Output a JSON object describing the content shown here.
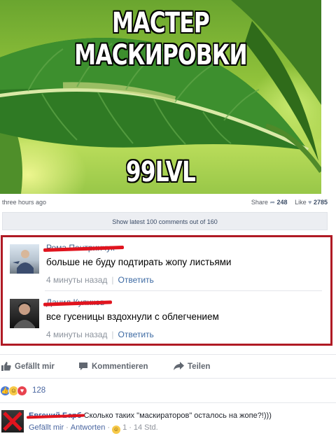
{
  "meme": {
    "title": "МАСТЕР МАСКИРОВКИ",
    "bottom_text": "99LVL"
  },
  "post_meta": {
    "time": "three hours ago",
    "share_label": "Share",
    "share_count": "248",
    "like_label": "Like",
    "like_count": "2785",
    "show_comments": "Show latest 100 comments out of 160"
  },
  "comments": [
    {
      "name": "Рома Пентринчук",
      "text": "больше не буду подтирать жопу листьями",
      "time": "4 минуты назад",
      "reply": "Ответить"
    },
    {
      "name": "Данил Куликов",
      "text": "все гусеницы вздохнули с облегчением",
      "time": "4 минуты назад",
      "reply": "Ответить"
    }
  ],
  "actions": {
    "like": "Gefällt mir",
    "comment": "Kommentieren",
    "share": "Teilen"
  },
  "reactions": {
    "count": "128"
  },
  "bottom_comment": {
    "name": "Евгений Барб",
    "text": "Сколько таких \"маскираторов\" осталось на жопе?!)))",
    "like": "Gefällt mir",
    "reply": "Antworten",
    "reaction_count": "1",
    "time": "14 Std."
  },
  "colors": {
    "highlight_border": "#b01a24",
    "redaction": "#e0141e",
    "link": "#385898"
  }
}
